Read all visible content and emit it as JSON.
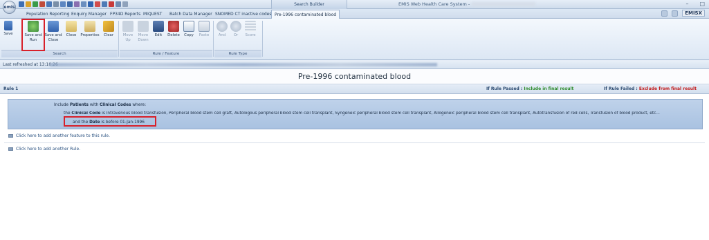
{
  "app": {
    "logo_text": "emis",
    "context_tab": "Search Builder",
    "title": "EMIS Web Health Care System -",
    "window_controls": [
      "–",
      "□"
    ]
  },
  "tabs": [
    {
      "label": "Population Reporting"
    },
    {
      "label": "Enquiry Manager"
    },
    {
      "label": "FP34D Reports"
    },
    {
      "label": "MIQUEST"
    },
    {
      "label": "Batch Data Manager"
    },
    {
      "label": "SNOMED CT inactive codes"
    },
    {
      "label": "Pre-1996 contaminated blood"
    }
  ],
  "tabs_right": {
    "brand": "EMISX"
  },
  "ribbon": {
    "groups": [
      {
        "label": "Search"
      },
      {
        "label": "Rule / Feature"
      },
      {
        "label": "Rule Type"
      }
    ],
    "buttons": [
      {
        "label": "Save"
      },
      {
        "label": "Save and Run"
      },
      {
        "label": "Save and Close"
      },
      {
        "label": "Close"
      },
      {
        "label": "Properties"
      },
      {
        "label": "Clear"
      },
      {
        "label": "Move Up"
      },
      {
        "label": "Move Down"
      },
      {
        "label": "Edit"
      },
      {
        "label": "Delete"
      },
      {
        "label": "Copy"
      },
      {
        "label": "Paste"
      },
      {
        "label": "And"
      },
      {
        "label": "Or"
      },
      {
        "label": "Score"
      }
    ]
  },
  "status": {
    "last_refreshed": "Last refreshed at 13:10:26"
  },
  "search": {
    "title": "Pre-1996 contaminated blood"
  },
  "rule": {
    "name": "Rule 1",
    "if_passed_label": "If Rule Passed :",
    "if_passed_value": "Include in final result",
    "if_failed_label": "If Rule Failed :",
    "if_failed_value": "Exclude from final result",
    "line1": {
      "prefix": "Include",
      "patients": "Patients",
      "with": "with",
      "clinical_codes": "Clinical Codes",
      "suffix": "where:"
    },
    "line2": {
      "prefix": "the",
      "clinical_code": "Clinical Code",
      "text": "is Intravenous blood transfusion, Peripheral blood stem cell graft, Autologous peripheral blood stem cell transplant, Syngeneic peripheral blood stem cell transplant, Allogeneic peripheral blood stem cell transplant, Autotransfusion of red cells, Transfusion of blood product, etc..."
    },
    "line3": {
      "prefix": "and the",
      "date": "Date",
      "text": "is before 01-Jan-1996"
    }
  },
  "links": {
    "add_feature": "Click here to add another feature to this rule.",
    "add_rule": "Click here to add another Rule."
  }
}
